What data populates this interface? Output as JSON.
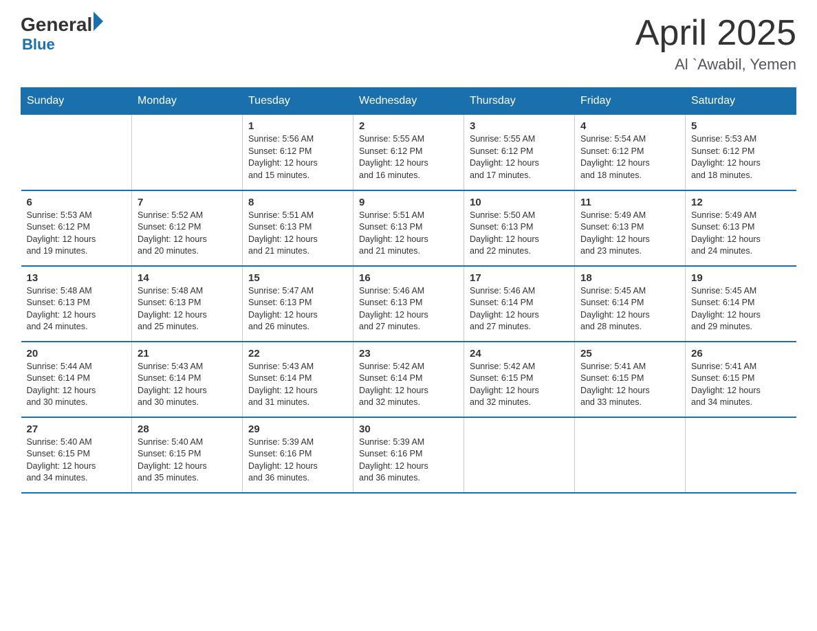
{
  "header": {
    "logo_general": "General",
    "logo_blue": "Blue",
    "main_title": "April 2025",
    "subtitle": "Al `Awabil, Yemen"
  },
  "weekdays": [
    "Sunday",
    "Monday",
    "Tuesday",
    "Wednesday",
    "Thursday",
    "Friday",
    "Saturday"
  ],
  "weeks": [
    [
      {
        "day": "",
        "info": ""
      },
      {
        "day": "",
        "info": ""
      },
      {
        "day": "1",
        "info": "Sunrise: 5:56 AM\nSunset: 6:12 PM\nDaylight: 12 hours\nand 15 minutes."
      },
      {
        "day": "2",
        "info": "Sunrise: 5:55 AM\nSunset: 6:12 PM\nDaylight: 12 hours\nand 16 minutes."
      },
      {
        "day": "3",
        "info": "Sunrise: 5:55 AM\nSunset: 6:12 PM\nDaylight: 12 hours\nand 17 minutes."
      },
      {
        "day": "4",
        "info": "Sunrise: 5:54 AM\nSunset: 6:12 PM\nDaylight: 12 hours\nand 18 minutes."
      },
      {
        "day": "5",
        "info": "Sunrise: 5:53 AM\nSunset: 6:12 PM\nDaylight: 12 hours\nand 18 minutes."
      }
    ],
    [
      {
        "day": "6",
        "info": "Sunrise: 5:53 AM\nSunset: 6:12 PM\nDaylight: 12 hours\nand 19 minutes."
      },
      {
        "day": "7",
        "info": "Sunrise: 5:52 AM\nSunset: 6:12 PM\nDaylight: 12 hours\nand 20 minutes."
      },
      {
        "day": "8",
        "info": "Sunrise: 5:51 AM\nSunset: 6:13 PM\nDaylight: 12 hours\nand 21 minutes."
      },
      {
        "day": "9",
        "info": "Sunrise: 5:51 AM\nSunset: 6:13 PM\nDaylight: 12 hours\nand 21 minutes."
      },
      {
        "day": "10",
        "info": "Sunrise: 5:50 AM\nSunset: 6:13 PM\nDaylight: 12 hours\nand 22 minutes."
      },
      {
        "day": "11",
        "info": "Sunrise: 5:49 AM\nSunset: 6:13 PM\nDaylight: 12 hours\nand 23 minutes."
      },
      {
        "day": "12",
        "info": "Sunrise: 5:49 AM\nSunset: 6:13 PM\nDaylight: 12 hours\nand 24 minutes."
      }
    ],
    [
      {
        "day": "13",
        "info": "Sunrise: 5:48 AM\nSunset: 6:13 PM\nDaylight: 12 hours\nand 24 minutes."
      },
      {
        "day": "14",
        "info": "Sunrise: 5:48 AM\nSunset: 6:13 PM\nDaylight: 12 hours\nand 25 minutes."
      },
      {
        "day": "15",
        "info": "Sunrise: 5:47 AM\nSunset: 6:13 PM\nDaylight: 12 hours\nand 26 minutes."
      },
      {
        "day": "16",
        "info": "Sunrise: 5:46 AM\nSunset: 6:13 PM\nDaylight: 12 hours\nand 27 minutes."
      },
      {
        "day": "17",
        "info": "Sunrise: 5:46 AM\nSunset: 6:14 PM\nDaylight: 12 hours\nand 27 minutes."
      },
      {
        "day": "18",
        "info": "Sunrise: 5:45 AM\nSunset: 6:14 PM\nDaylight: 12 hours\nand 28 minutes."
      },
      {
        "day": "19",
        "info": "Sunrise: 5:45 AM\nSunset: 6:14 PM\nDaylight: 12 hours\nand 29 minutes."
      }
    ],
    [
      {
        "day": "20",
        "info": "Sunrise: 5:44 AM\nSunset: 6:14 PM\nDaylight: 12 hours\nand 30 minutes."
      },
      {
        "day": "21",
        "info": "Sunrise: 5:43 AM\nSunset: 6:14 PM\nDaylight: 12 hours\nand 30 minutes."
      },
      {
        "day": "22",
        "info": "Sunrise: 5:43 AM\nSunset: 6:14 PM\nDaylight: 12 hours\nand 31 minutes."
      },
      {
        "day": "23",
        "info": "Sunrise: 5:42 AM\nSunset: 6:14 PM\nDaylight: 12 hours\nand 32 minutes."
      },
      {
        "day": "24",
        "info": "Sunrise: 5:42 AM\nSunset: 6:15 PM\nDaylight: 12 hours\nand 32 minutes."
      },
      {
        "day": "25",
        "info": "Sunrise: 5:41 AM\nSunset: 6:15 PM\nDaylight: 12 hours\nand 33 minutes."
      },
      {
        "day": "26",
        "info": "Sunrise: 5:41 AM\nSunset: 6:15 PM\nDaylight: 12 hours\nand 34 minutes."
      }
    ],
    [
      {
        "day": "27",
        "info": "Sunrise: 5:40 AM\nSunset: 6:15 PM\nDaylight: 12 hours\nand 34 minutes."
      },
      {
        "day": "28",
        "info": "Sunrise: 5:40 AM\nSunset: 6:15 PM\nDaylight: 12 hours\nand 35 minutes."
      },
      {
        "day": "29",
        "info": "Sunrise: 5:39 AM\nSunset: 6:16 PM\nDaylight: 12 hours\nand 36 minutes."
      },
      {
        "day": "30",
        "info": "Sunrise: 5:39 AM\nSunset: 6:16 PM\nDaylight: 12 hours\nand 36 minutes."
      },
      {
        "day": "",
        "info": ""
      },
      {
        "day": "",
        "info": ""
      },
      {
        "day": "",
        "info": ""
      }
    ]
  ]
}
